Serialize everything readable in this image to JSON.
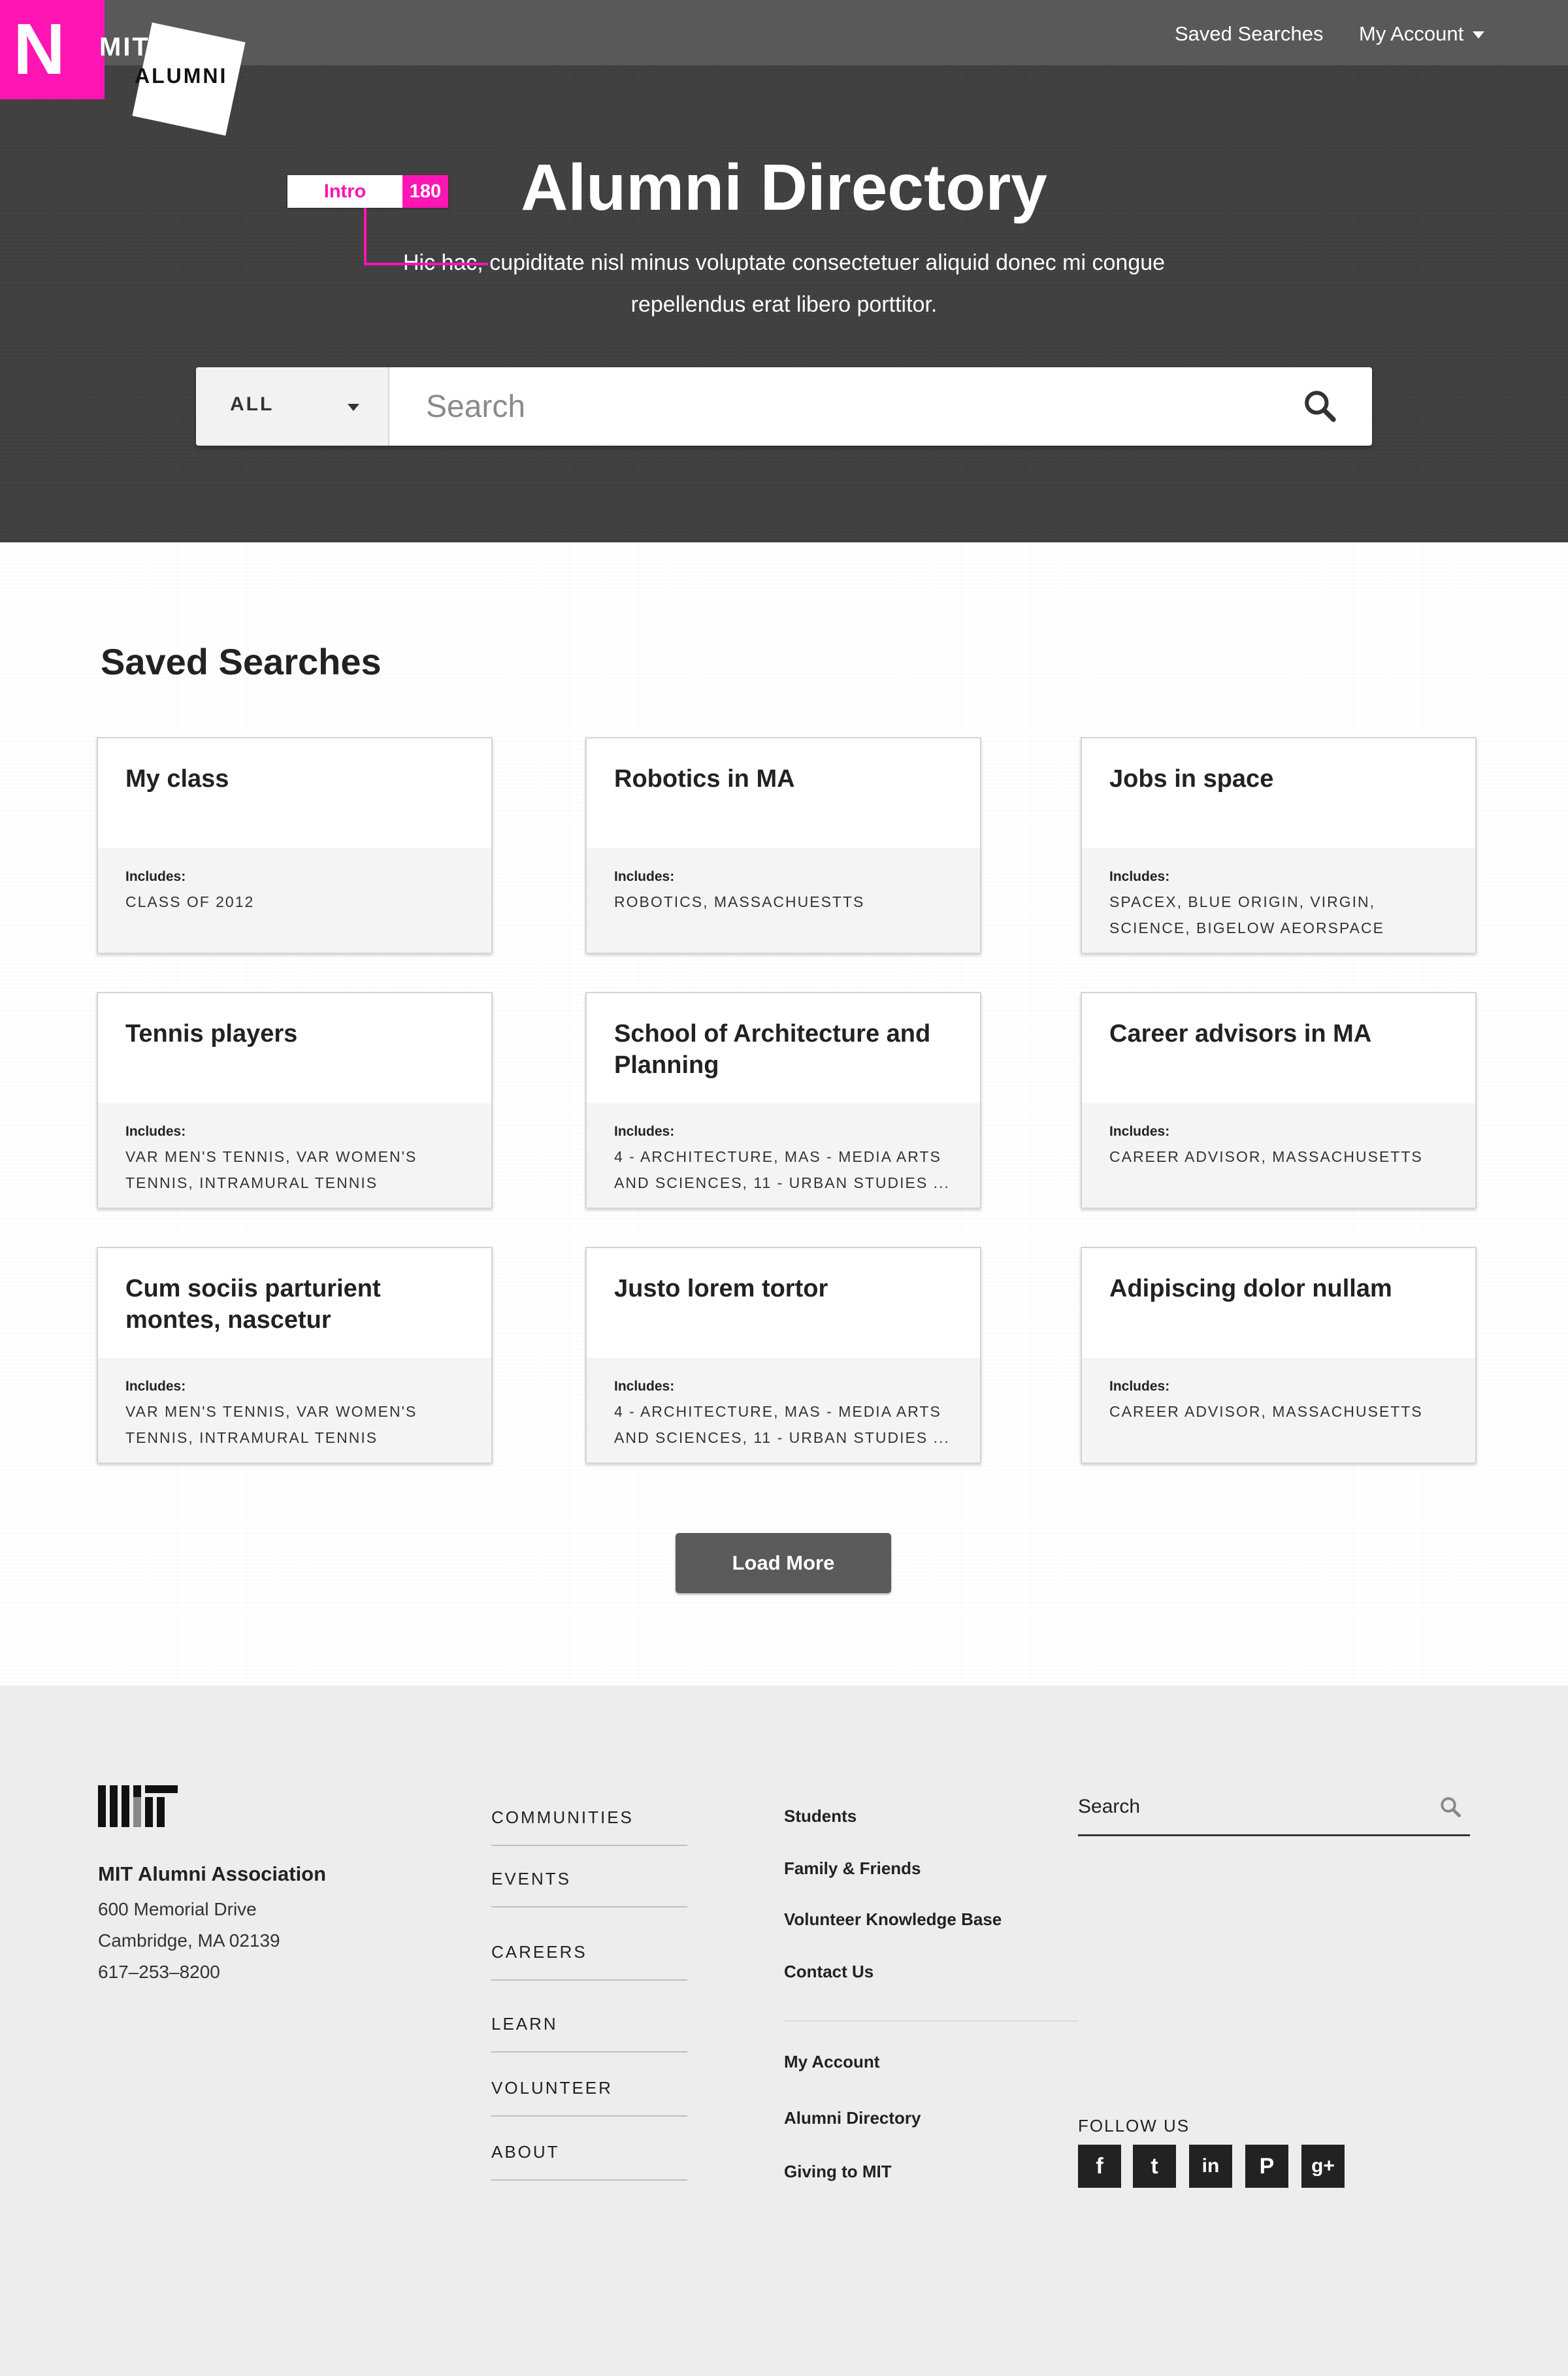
{
  "brand": {
    "badge_letter": "N",
    "logo_line1": "MIT",
    "logo_line2": "ALUMNI"
  },
  "topnav": {
    "saved_searches": "Saved Searches",
    "my_account": "My Account"
  },
  "annotation": {
    "label": "Intro",
    "count": "180"
  },
  "hero": {
    "title": "Alumni Directory",
    "subtitle": "Hic hac, cupiditate nisl minus voluptate consectetuer aliquid donec mi congue repellendus erat libero porttitor."
  },
  "search": {
    "filter_value": "ALL",
    "placeholder": "Search"
  },
  "saved": {
    "heading": "Saved Searches",
    "includes_label": "Includes:",
    "cards": [
      {
        "title": "My class",
        "includes": "CLASS OF 2012"
      },
      {
        "title": "Robotics in MA",
        "includes": "ROBOTICS, MASSACHUESTTS"
      },
      {
        "title": "Jobs in space",
        "includes": "SPACEX, BLUE ORIGIN, VIRGIN, SCIENCE, BIGELOW AEORSPACE"
      },
      {
        "title": "Tennis players",
        "includes": "VAR MEN'S TENNIS, VAR WOMEN'S TENNIS, INTRAMURAL TENNIS"
      },
      {
        "title": "School of Architecture and Planning",
        "includes": "4 - ARCHITECTURE, MAS - MEDIA ARTS AND SCIENCES, 11 - URBAN STUDIES ..."
      },
      {
        "title": "Career advisors in MA",
        "includes": "CAREER ADVISOR, MASSACHUSETTS"
      },
      {
        "title": "Cum sociis parturient montes, nascetur",
        "includes": "VAR MEN'S TENNIS, VAR WOMEN'S TENNIS, INTRAMURAL TENNIS"
      },
      {
        "title": "Justo lorem tortor",
        "includes": "4 - ARCHITECTURE, MAS - MEDIA ARTS AND SCIENCES, 11 - URBAN STUDIES ..."
      },
      {
        "title": "Adipiscing dolor nullam",
        "includes": "CAREER ADVISOR, MASSACHUSETTS"
      }
    ],
    "load_more": "Load More"
  },
  "footer": {
    "org_name": "MIT Alumni Association",
    "address": [
      "600 Memorial Drive",
      "Cambridge, MA 02139",
      "617–253–8200"
    ],
    "nav": [
      "COMMUNITIES",
      "EVENTS",
      "CAREERS",
      "LEARN",
      "VOLUNTEER",
      "ABOUT"
    ],
    "links_group1": [
      "Students",
      "Family & Friends",
      "Volunteer Knowledge Base",
      "Contact Us"
    ],
    "links_group2": [
      "My Account",
      "Alumni Directory",
      "Giving to MIT"
    ],
    "search_placeholder": "Search",
    "follow_label": "FOLLOW US",
    "social": [
      {
        "icon": "facebook-icon",
        "glyph": "f"
      },
      {
        "icon": "twitter-icon",
        "glyph": "t"
      },
      {
        "icon": "linkedin-icon",
        "glyph": "in"
      },
      {
        "icon": "pinterest-icon",
        "glyph": "P"
      },
      {
        "icon": "google-plus-icon",
        "glyph": "g+"
      }
    ]
  },
  "colors": {
    "accent_magenta": "#ff14b4",
    "hero_bg": "#3f3f3f",
    "topbar_bg": "#595959",
    "button_bg": "#5a5a5a",
    "footer_bg": "#ededed"
  }
}
